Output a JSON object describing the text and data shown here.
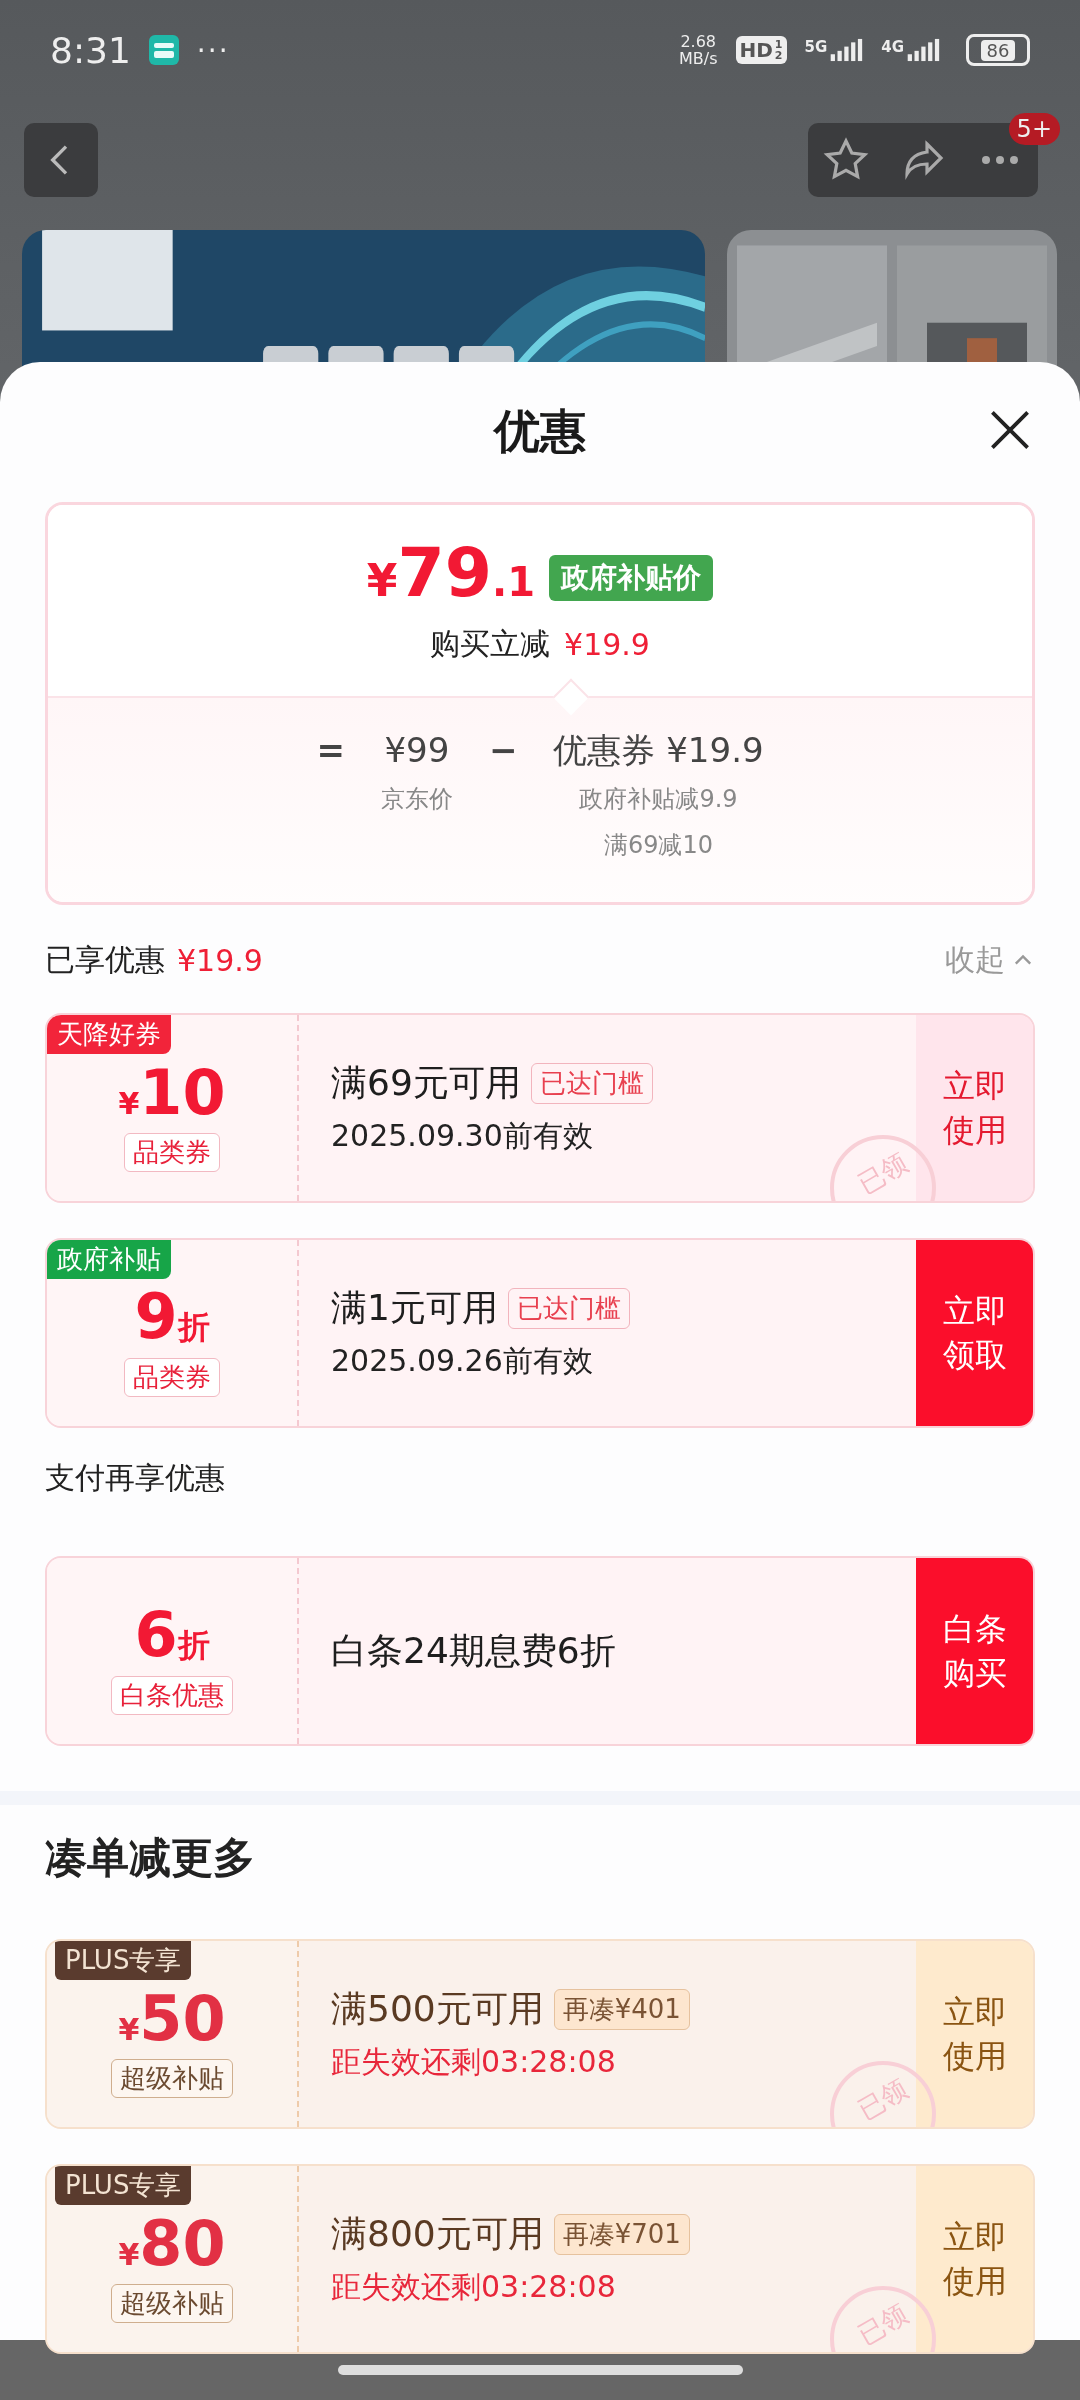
{
  "status_bar": {
    "time": "8:31",
    "more": "···",
    "speed": "2.68",
    "speed_unit": "MB/s",
    "hd": "HD",
    "hd_sub": [
      "1",
      "2"
    ],
    "networks": [
      "5G",
      "4G"
    ],
    "battery": "86"
  },
  "nav": {
    "badge": "5+"
  },
  "sheet": {
    "title": "优惠"
  },
  "price_card": {
    "symbol": "¥",
    "price_int": "79",
    "price_dec": ".1",
    "price_tag": "政府补贴价",
    "instant_label": "购买立减",
    "instant_amount": "¥19.9",
    "equals": "=",
    "base_price": "¥99",
    "base_label": "京东价",
    "minus": "−",
    "coupon_total": "优惠券 ¥19.9",
    "details": [
      "政府补贴减9.9",
      "满69减10"
    ]
  },
  "enjoyed": {
    "label": "已享优惠",
    "amount": "¥19.9",
    "collapse": "收起"
  },
  "coupons": [
    {
      "kind": "standard",
      "tag": "天降好券",
      "color": "#f2243a",
      "prefix": "¥",
      "value": "10",
      "type": "品类券",
      "condition": "满69元可用",
      "badge": "已达门槛",
      "note": "2025.09.30前有效",
      "action": "立即使用",
      "filled": false,
      "stamp": "已领"
    },
    {
      "kind": "standard",
      "tag": "政府补贴",
      "color": "#17a548",
      "value": "9",
      "suffix": "折",
      "type": "品类券",
      "condition": "满1元可用",
      "badge": "已达门槛",
      "note": "2025.09.26前有效",
      "action": "立即领取",
      "filled": true
    }
  ],
  "pay_section": {
    "title": "支付再享优惠",
    "coupons": [
      {
        "kind": "standard",
        "value": "6",
        "suffix": "折",
        "type": "白条优惠",
        "condition": "白条24期息费6折",
        "action": "白条购买",
        "filled": true
      }
    ]
  },
  "more_section": {
    "title": "凑单减更多",
    "coupons": [
      {
        "kind": "plus",
        "tag": "PLUS专享",
        "color": "#5a3b2e",
        "prefix": "¥",
        "value": "50",
        "type": "超级补贴",
        "condition": "满500元可用",
        "badge": "再凑¥401",
        "note": "距失效还剩03:28:08",
        "action": "立即使用",
        "filled": false,
        "stamp": "已领"
      },
      {
        "kind": "plus",
        "tag": "PLUS专享",
        "color": "#5a3b2e",
        "prefix": "¥",
        "value": "80",
        "type": "超级补贴",
        "condition": "满800元可用",
        "badge": "再凑¥701",
        "note": "距失效还剩03:28:08",
        "action": "立即使用",
        "filled": false,
        "stamp": "已领"
      }
    ]
  }
}
